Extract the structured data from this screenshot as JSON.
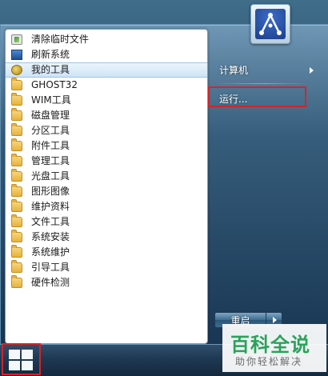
{
  "programs": [
    {
      "label": "清除临时文件",
      "icon": "broom-icon"
    },
    {
      "label": "刷新系统",
      "icon": "monitor-icon"
    },
    {
      "label": "我的工具",
      "icon": "tools-icon",
      "selected": true
    },
    {
      "label": "GHOST32",
      "icon": "folder-icon"
    },
    {
      "label": "WIM工具",
      "icon": "folder-icon"
    },
    {
      "label": "磁盘管理",
      "icon": "folder-icon"
    },
    {
      "label": "分区工具",
      "icon": "folder-icon"
    },
    {
      "label": "附件工具",
      "icon": "folder-icon"
    },
    {
      "label": "管理工具",
      "icon": "folder-icon"
    },
    {
      "label": "光盘工具",
      "icon": "folder-icon"
    },
    {
      "label": "图形图像",
      "icon": "folder-icon"
    },
    {
      "label": "维护资料",
      "icon": "folder-icon"
    },
    {
      "label": "文件工具",
      "icon": "folder-icon"
    },
    {
      "label": "系统安装",
      "icon": "folder-icon"
    },
    {
      "label": "系统维护",
      "icon": "folder-icon"
    },
    {
      "label": "引导工具",
      "icon": "folder-icon"
    },
    {
      "label": "硬件检测",
      "icon": "folder-icon"
    }
  ],
  "right_panel": {
    "computer_label": "计算机",
    "run_label": "运行..."
  },
  "power": {
    "restart_label": "重启"
  },
  "watermark": {
    "title": "百科全说",
    "subtitle": "助你轻松解决"
  },
  "colors": {
    "highlight_border": "#d5232a",
    "watermark_green": "#2aa25a",
    "selected_bg": "#cfe4f6"
  }
}
